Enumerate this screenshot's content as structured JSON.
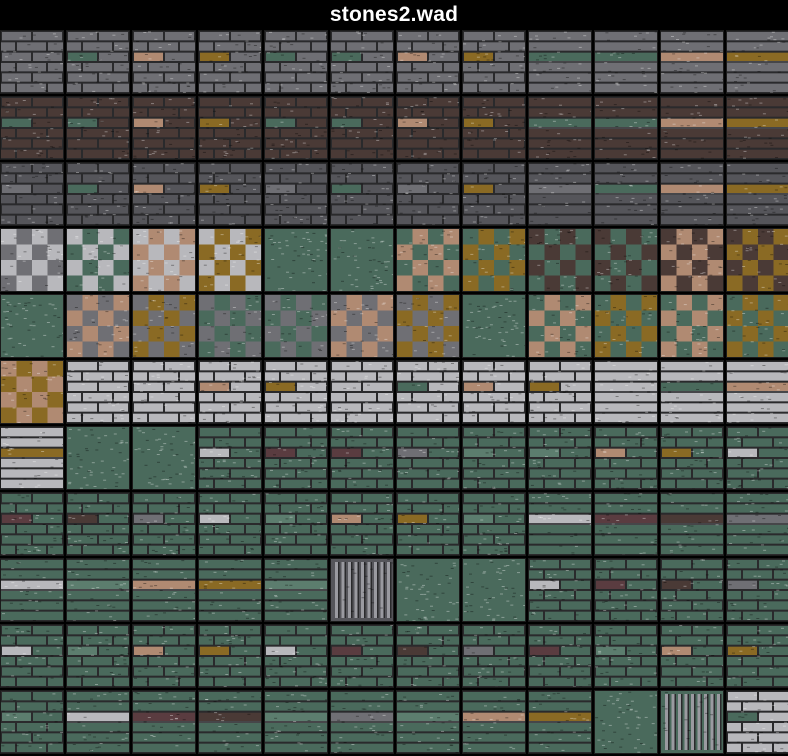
{
  "title": "stones2.wad",
  "palette": {
    "grey": "#6f6f74",
    "grey_dark": "#55555a",
    "green": "#4a6a5c",
    "green_light": "#5c7d6e",
    "tan": "#b08a72",
    "gold": "#8a6a24",
    "brown": "#4a3a36",
    "maroon": "#5a3c40",
    "light": "#b8b8bc",
    "mortar": "#2a2a2c",
    "mortar_light": "#9a9aa0"
  },
  "textures": [
    {
      "name": "r1c1",
      "pattern": "brick",
      "base": "grey"
    },
    {
      "name": "r1c2",
      "pattern": "brick",
      "base": "grey",
      "accent": "green"
    },
    {
      "name": "r1c3",
      "pattern": "brick",
      "base": "grey",
      "accent": "tan"
    },
    {
      "name": "r1c4",
      "pattern": "brick",
      "base": "grey",
      "accent": "gold"
    },
    {
      "name": "r1c5",
      "pattern": "brick",
      "base": "grey",
      "accent": "green"
    },
    {
      "name": "r1c6",
      "pattern": "brick",
      "base": "grey",
      "accent": "green"
    },
    {
      "name": "r1c7",
      "pattern": "brick",
      "base": "grey",
      "accent": "tan"
    },
    {
      "name": "r1c8",
      "pattern": "brick",
      "base": "grey",
      "accent": "gold"
    },
    {
      "name": "r1c9",
      "pattern": "band",
      "base": "grey",
      "accent": "green"
    },
    {
      "name": "r1c10",
      "pattern": "band",
      "base": "grey",
      "accent": "green"
    },
    {
      "name": "r1c11",
      "pattern": "band",
      "base": "grey",
      "accent": "tan"
    },
    {
      "name": "r1c12",
      "pattern": "band",
      "base": "grey",
      "accent": "gold"
    },
    {
      "name": "r2c1",
      "pattern": "brick",
      "base": "brown",
      "accent": "green"
    },
    {
      "name": "r2c2",
      "pattern": "brick",
      "base": "brown",
      "accent": "green"
    },
    {
      "name": "r2c3",
      "pattern": "brick",
      "base": "brown",
      "accent": "tan"
    },
    {
      "name": "r2c4",
      "pattern": "brick",
      "base": "brown",
      "accent": "gold"
    },
    {
      "name": "r2c5",
      "pattern": "brick",
      "base": "brown",
      "accent": "green"
    },
    {
      "name": "r2c6",
      "pattern": "brick",
      "base": "brown",
      "accent": "green"
    },
    {
      "name": "r2c7",
      "pattern": "brick",
      "base": "brown",
      "accent": "tan"
    },
    {
      "name": "r2c8",
      "pattern": "brick",
      "base": "brown",
      "accent": "gold"
    },
    {
      "name": "r2c9",
      "pattern": "band",
      "base": "brown",
      "accent": "green"
    },
    {
      "name": "r2c10",
      "pattern": "band",
      "base": "brown",
      "accent": "green"
    },
    {
      "name": "r2c11",
      "pattern": "band",
      "base": "brown",
      "accent": "tan"
    },
    {
      "name": "r2c12",
      "pattern": "band",
      "base": "brown",
      "accent": "gold"
    },
    {
      "name": "r3c1",
      "pattern": "brick",
      "base": "grey_dark",
      "accent": "grey"
    },
    {
      "name": "r3c2",
      "pattern": "brick",
      "base": "grey_dark",
      "accent": "green"
    },
    {
      "name": "r3c3",
      "pattern": "brick",
      "base": "grey_dark",
      "accent": "tan"
    },
    {
      "name": "r3c4",
      "pattern": "brick",
      "base": "grey_dark",
      "accent": "gold"
    },
    {
      "name": "r3c5",
      "pattern": "brick",
      "base": "grey_dark",
      "accent": "grey"
    },
    {
      "name": "r3c6",
      "pattern": "brick",
      "base": "grey_dark",
      "accent": "green"
    },
    {
      "name": "r3c7",
      "pattern": "brick",
      "base": "grey_dark",
      "accent": "grey"
    },
    {
      "name": "r3c8",
      "pattern": "brick",
      "base": "grey_dark",
      "accent": "gold"
    },
    {
      "name": "r3c9",
      "pattern": "band",
      "base": "grey_dark",
      "accent": "grey"
    },
    {
      "name": "r3c10",
      "pattern": "band",
      "base": "grey_dark",
      "accent": "green"
    },
    {
      "name": "r3c11",
      "pattern": "band",
      "base": "grey_dark",
      "accent": "tan"
    },
    {
      "name": "r3c12",
      "pattern": "band",
      "base": "grey_dark",
      "accent": "gold"
    },
    {
      "name": "r4c1",
      "pattern": "checker",
      "a": "light",
      "b": "grey"
    },
    {
      "name": "r4c2",
      "pattern": "checker",
      "a": "light",
      "b": "green"
    },
    {
      "name": "r4c3",
      "pattern": "checker",
      "a": "light",
      "b": "tan"
    },
    {
      "name": "r4c4",
      "pattern": "checker",
      "a": "light",
      "b": "gold"
    },
    {
      "name": "r4c5",
      "pattern": "solid",
      "base": "green"
    },
    {
      "name": "r4c6",
      "pattern": "solid",
      "base": "green"
    },
    {
      "name": "r4c7",
      "pattern": "checker",
      "a": "green",
      "b": "tan"
    },
    {
      "name": "r4c8",
      "pattern": "checker",
      "a": "green",
      "b": "gold"
    },
    {
      "name": "r4c9",
      "pattern": "checker",
      "a": "brown",
      "b": "green"
    },
    {
      "name": "r4c10",
      "pattern": "checker",
      "a": "brown",
      "b": "green"
    },
    {
      "name": "r4c11",
      "pattern": "checker",
      "a": "brown",
      "b": "tan"
    },
    {
      "name": "r4c12",
      "pattern": "checker",
      "a": "brown",
      "b": "gold"
    },
    {
      "name": "r5c1",
      "pattern": "solid",
      "base": "green"
    },
    {
      "name": "r5c2",
      "pattern": "checker",
      "a": "grey",
      "b": "tan"
    },
    {
      "name": "r5c3",
      "pattern": "checker",
      "a": "grey",
      "b": "gold"
    },
    {
      "name": "r5c4",
      "pattern": "checker",
      "a": "grey",
      "b": "green"
    },
    {
      "name": "r5c5",
      "pattern": "checker",
      "a": "grey",
      "b": "green"
    },
    {
      "name": "r5c6",
      "pattern": "checker",
      "a": "grey",
      "b": "tan"
    },
    {
      "name": "r5c7",
      "pattern": "checker",
      "a": "grey",
      "b": "gold"
    },
    {
      "name": "r5c8",
      "pattern": "solid",
      "base": "green"
    },
    {
      "name": "r5c9",
      "pattern": "checker",
      "a": "green",
      "b": "tan"
    },
    {
      "name": "r5c10",
      "pattern": "checker",
      "a": "green",
      "b": "gold"
    },
    {
      "name": "r5c11",
      "pattern": "checker",
      "a": "green",
      "b": "tan"
    },
    {
      "name": "r5c12",
      "pattern": "checker",
      "a": "green",
      "b": "gold"
    },
    {
      "name": "r6c1",
      "pattern": "checker",
      "a": "tan",
      "b": "gold"
    },
    {
      "name": "r6c2",
      "pattern": "brick",
      "base": "light",
      "accent": "light"
    },
    {
      "name": "r6c3",
      "pattern": "brick",
      "base": "light",
      "accent": "light"
    },
    {
      "name": "r6c4",
      "pattern": "brick",
      "base": "light",
      "accent": "tan"
    },
    {
      "name": "r6c5",
      "pattern": "brick",
      "base": "light",
      "accent": "gold"
    },
    {
      "name": "r6c6",
      "pattern": "brick",
      "base": "light",
      "accent": "light"
    },
    {
      "name": "r6c7",
      "pattern": "brick",
      "base": "light",
      "accent": "green"
    },
    {
      "name": "r6c8",
      "pattern": "brick",
      "base": "light",
      "accent": "tan"
    },
    {
      "name": "r6c9",
      "pattern": "brick",
      "base": "light",
      "accent": "gold"
    },
    {
      "name": "r6c10",
      "pattern": "band",
      "base": "light",
      "accent": "light"
    },
    {
      "name": "r6c11",
      "pattern": "band",
      "base": "light",
      "accent": "green"
    },
    {
      "name": "r6c12",
      "pattern": "band",
      "base": "light",
      "accent": "tan"
    },
    {
      "name": "r7c1",
      "pattern": "band",
      "base": "light",
      "accent": "gold"
    },
    {
      "name": "r7c2",
      "pattern": "solid",
      "base": "green"
    },
    {
      "name": "r7c3",
      "pattern": "solid",
      "base": "green"
    },
    {
      "name": "r7c4",
      "pattern": "brick",
      "base": "green",
      "accent": "light"
    },
    {
      "name": "r7c5",
      "pattern": "brick",
      "base": "green",
      "accent": "maroon"
    },
    {
      "name": "r7c6",
      "pattern": "brick",
      "base": "green",
      "accent": "maroon"
    },
    {
      "name": "r7c7",
      "pattern": "brick",
      "base": "green",
      "accent": "grey"
    },
    {
      "name": "r7c8",
      "pattern": "brick",
      "base": "green",
      "accent": "green_light"
    },
    {
      "name": "r7c9",
      "pattern": "brick",
      "base": "green",
      "accent": "green_light"
    },
    {
      "name": "r7c10",
      "pattern": "brick",
      "base": "green",
      "accent": "tan"
    },
    {
      "name": "r7c11",
      "pattern": "brick",
      "base": "green",
      "accent": "gold"
    },
    {
      "name": "r7c12",
      "pattern": "brick",
      "base": "green",
      "accent": "light"
    },
    {
      "name": "r8c1",
      "pattern": "brick",
      "base": "green",
      "accent": "maroon"
    },
    {
      "name": "r8c2",
      "pattern": "brick",
      "base": "green",
      "accent": "brown"
    },
    {
      "name": "r8c3",
      "pattern": "brick",
      "base": "green",
      "accent": "grey"
    },
    {
      "name": "r8c4",
      "pattern": "brick",
      "base": "green",
      "accent": "light"
    },
    {
      "name": "r8c5",
      "pattern": "brick",
      "base": "green",
      "accent": "green_light"
    },
    {
      "name": "r8c6",
      "pattern": "brick",
      "base": "green",
      "accent": "tan"
    },
    {
      "name": "r8c7",
      "pattern": "brick",
      "base": "green",
      "accent": "gold"
    },
    {
      "name": "r8c8",
      "pattern": "brick",
      "base": "green",
      "accent": "green_light"
    },
    {
      "name": "r8c9",
      "pattern": "band",
      "base": "green",
      "accent": "light"
    },
    {
      "name": "r8c10",
      "pattern": "band",
      "base": "green",
      "accent": "maroon"
    },
    {
      "name": "r8c11",
      "pattern": "band",
      "base": "green",
      "accent": "brown"
    },
    {
      "name": "r8c12",
      "pattern": "band",
      "base": "green",
      "accent": "grey"
    },
    {
      "name": "r9c1",
      "pattern": "band",
      "base": "green",
      "accent": "light"
    },
    {
      "name": "r9c2",
      "pattern": "band",
      "base": "green",
      "accent": "green_light"
    },
    {
      "name": "r9c3",
      "pattern": "band",
      "base": "green",
      "accent": "tan"
    },
    {
      "name": "r9c4",
      "pattern": "band",
      "base": "green",
      "accent": "gold"
    },
    {
      "name": "r9c5",
      "pattern": "band",
      "base": "green",
      "accent": "green_light"
    },
    {
      "name": "r9c6",
      "pattern": "ribbed",
      "base": "grey_dark"
    },
    {
      "name": "r9c7",
      "pattern": "solid",
      "base": "green"
    },
    {
      "name": "r9c8",
      "pattern": "solid",
      "base": "green"
    },
    {
      "name": "r9c9",
      "pattern": "brick",
      "base": "green",
      "accent": "light"
    },
    {
      "name": "r9c10",
      "pattern": "brick",
      "base": "green",
      "accent": "maroon"
    },
    {
      "name": "r9c11",
      "pattern": "brick",
      "base": "green",
      "accent": "brown"
    },
    {
      "name": "r9c12",
      "pattern": "brick",
      "base": "green",
      "accent": "grey"
    },
    {
      "name": "r10c1",
      "pattern": "brick",
      "base": "green",
      "accent": "light"
    },
    {
      "name": "r10c2",
      "pattern": "brick",
      "base": "green",
      "accent": "green_light"
    },
    {
      "name": "r10c3",
      "pattern": "brick",
      "base": "green",
      "accent": "tan"
    },
    {
      "name": "r10c4",
      "pattern": "brick",
      "base": "green",
      "accent": "gold"
    },
    {
      "name": "r10c5",
      "pattern": "brick",
      "base": "green",
      "accent": "light"
    },
    {
      "name": "r10c6",
      "pattern": "brick",
      "base": "green",
      "accent": "maroon"
    },
    {
      "name": "r10c7",
      "pattern": "brick",
      "base": "green",
      "accent": "brown"
    },
    {
      "name": "r10c8",
      "pattern": "brick",
      "base": "green",
      "accent": "grey"
    },
    {
      "name": "r10c9",
      "pattern": "brick",
      "base": "green",
      "accent": "maroon"
    },
    {
      "name": "r10c10",
      "pattern": "brick",
      "base": "green",
      "accent": "green_light"
    },
    {
      "name": "r10c11",
      "pattern": "brick",
      "base": "green",
      "accent": "tan"
    },
    {
      "name": "r10c12",
      "pattern": "brick",
      "base": "green",
      "accent": "gold"
    },
    {
      "name": "r11c1",
      "pattern": "brick",
      "base": "green",
      "accent": "green_light"
    },
    {
      "name": "r11c2",
      "pattern": "band",
      "base": "green",
      "accent": "light"
    },
    {
      "name": "r11c3",
      "pattern": "band",
      "base": "green",
      "accent": "maroon"
    },
    {
      "name": "r11c4",
      "pattern": "band",
      "base": "green",
      "accent": "brown"
    },
    {
      "name": "r11c5",
      "pattern": "band",
      "base": "green",
      "accent": "green_light"
    },
    {
      "name": "r11c6",
      "pattern": "band",
      "base": "green",
      "accent": "grey"
    },
    {
      "name": "r11c7",
      "pattern": "band",
      "base": "green",
      "accent": "green_light"
    },
    {
      "name": "r11c8",
      "pattern": "band",
      "base": "green",
      "accent": "tan"
    },
    {
      "name": "r11c9",
      "pattern": "band",
      "base": "green",
      "accent": "gold"
    },
    {
      "name": "r11c10",
      "pattern": "solid",
      "base": "green"
    },
    {
      "name": "r11c11",
      "pattern": "ribbed",
      "base": "green"
    },
    {
      "name": "r11c12",
      "pattern": "brick",
      "base": "light",
      "accent": "green"
    }
  ]
}
